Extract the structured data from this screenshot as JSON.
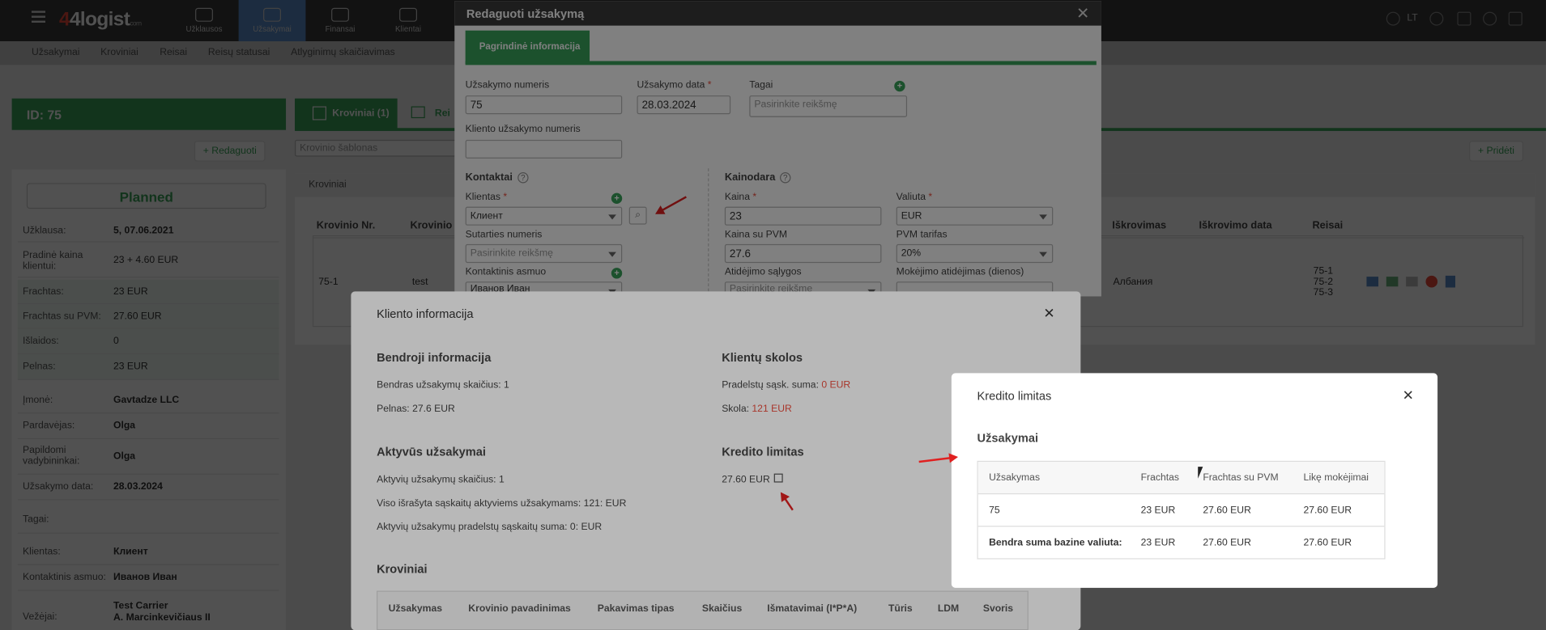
{
  "app": {
    "logo_text": "4logist",
    "logo_suffix": "com",
    "lang": "LT"
  },
  "nav": [
    {
      "label": "Užklausos",
      "icon": "chat-icon"
    },
    {
      "label": "Užsakymai",
      "icon": "clipboard-icon"
    },
    {
      "label": "Finansai",
      "icon": "money-bag-icon"
    },
    {
      "label": "Klientai",
      "icon": "users-icon"
    }
  ],
  "subnav": [
    "Užsakymai",
    "Kroviniai",
    "Reisai",
    "Reisų statusai",
    "Atlyginimų skaičiavimas"
  ],
  "left": {
    "id": "ID: 75",
    "edit": "Redaguoti",
    "status": "Planned",
    "rows": [
      {
        "k": "Užklausa:",
        "v": "5, 07.06.2021"
      },
      {
        "k": "Pradinė kaina klientui:",
        "v": "23 + 4.60 EUR"
      },
      {
        "k": "Frachtas:",
        "v": "23 EUR"
      },
      {
        "k": "Frachtas su PVM:",
        "v": "27.60 EUR"
      },
      {
        "k": "Išlaidos:",
        "v": "0"
      },
      {
        "k": "Pelnas:",
        "v": "23 EUR"
      },
      {
        "k": "Įmonė:",
        "v": "Gavtadze LLC"
      },
      {
        "k": "Pardavėjas:",
        "v": "Olga"
      },
      {
        "k": "Papildomi vadybininkai:",
        "v": "Olga"
      },
      {
        "k": "Užsakymo data:",
        "v": "28.03.2024"
      },
      {
        "k": "Tagai:",
        "v": ""
      },
      {
        "k": "Klientas:",
        "v": "Клиент"
      },
      {
        "k": "Kontaktinis asmuo:",
        "v": "Иванов Иван"
      },
      {
        "k": "Vežėjai:",
        "v": "Test Carrier"
      },
      {
        "k": "",
        "v": "A. Marcinkevičiaus II"
      }
    ]
  },
  "main": {
    "tab1": "Kroviniai (1)",
    "tab2": "Rei",
    "search_ph": "Krovinio šablonas",
    "add": "Pridėti",
    "panel_title": "Kroviniai",
    "headers": {
      "nr": "Krovinio Nr.",
      "name": "Krovinio",
      "unload": "Iškrovimas",
      "unload_date": "Iškrovimo data",
      "trips": "Reisai"
    },
    "row": {
      "nr": "75-1",
      "name": "test",
      "unload": "Албания",
      "trips": [
        "75-1",
        "75-2",
        "75-3"
      ]
    }
  },
  "edit": {
    "title": "Redaguoti užsakymą",
    "tab": "Pagrindinė informacija",
    "order_no_label": "Užsakymo numeris",
    "order_no": "75",
    "date_label": "Užsakymo data",
    "date": "28.03.2024",
    "tags_label": "Tagai",
    "tags_ph": "Pasirinkite reikšmę",
    "client_order_label": "Kliento užsakymo numeris",
    "contacts": "Kontaktai",
    "client_label": "Klientas",
    "client": "Клиент",
    "contract_label": "Sutarties numeris",
    "contract_ph": "Pasirinkite reikšmę",
    "contact_label": "Kontaktinis asmuo",
    "contact": "Иванов Иван",
    "pricing": "Kainodara",
    "price_label": "Kaina",
    "price": "23",
    "currency_label": "Valiuta",
    "currency": "EUR",
    "price_vat_label": "Kaina su PVM",
    "price_vat": "27.6",
    "vat_label": "PVM tarifas",
    "vat": "20%",
    "delay_label": "Atidėjimo sąlygos",
    "delay_ph": "Pasirinkite reikšmę",
    "pay_delay_label": "Mokėjimo atidėjimas (dienos)"
  },
  "client_modal": {
    "title": "Kliento informacija",
    "general": "Bendroji informacija",
    "orders_count": "Bendras užsakymų skaičius: 1",
    "profit": "Pelnas: 27.6 EUR",
    "debts": "Klientų skolos",
    "overdue_label": "Pradelstų sąsk. suma: ",
    "overdue": "0 EUR",
    "debt_label": "Skola: ",
    "debt": "121 EUR",
    "active": "Aktyvūs užsakymai",
    "active_count": "Aktyvių užsakymų skaičius: 1",
    "active_invoiced": "Viso išrašyta sąskaitų aktyviems užsakymams: 121: EUR",
    "active_overdue": "Aktyvių užsakymų pradelstų sąskaitų suma: 0: EUR",
    "credit": "Kredito limitas",
    "credit_value": "27.60 EUR",
    "cargo": "Kroviniai",
    "cargo_headers": [
      "Užsakymas",
      "Krovinio pavadinimas",
      "Pakavimas tipas",
      "Skaičius",
      "Išmatavimai (I*P*A)",
      "Tūris",
      "LDM",
      "Svoris"
    ]
  },
  "credit_modal": {
    "title": "Kredito limitas",
    "section": "Užsakymai",
    "headers": [
      "Užsakymas",
      "Frachtas",
      "Frachtas su PVM",
      "Likę mokėjimai"
    ],
    "row": [
      "75",
      "23 EUR",
      "27.60 EUR",
      "27.60 EUR"
    ],
    "total": [
      "Bendra suma bazine valiuta:",
      "23 EUR",
      "27.60 EUR",
      "27.60 EUR"
    ]
  }
}
